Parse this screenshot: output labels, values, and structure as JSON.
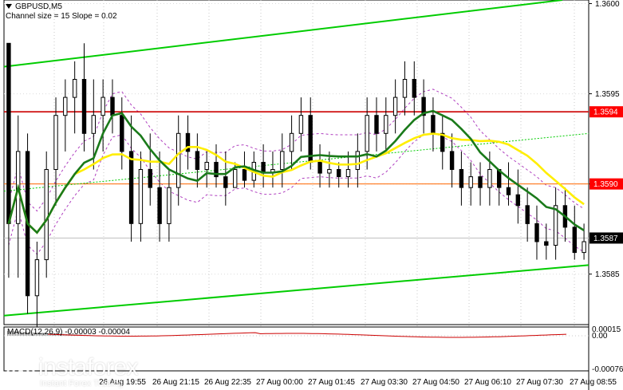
{
  "header": {
    "symbol": "GBPUSD,M5",
    "channel_text": "Channel size = 15 Slope = 0.02"
  },
  "macd": {
    "label": "MACD(12,26,9) -0.00003 -0.00004",
    "axis_top": "0.00015",
    "axis_zero": "0.00",
    "axis_bottom": "-0.00076"
  },
  "logo": {
    "name": "instaforex",
    "tagline": "Instant Forex Trading",
    "brand_color": "#ffffff"
  },
  "chart_data": {
    "type": "candlestick",
    "ylim": [
      1.35822,
      1.36002
    ],
    "y_ticks": [
      1.36,
      1.3595,
      1.359,
      1.3585
    ],
    "y_tick_labels": [
      "1.3600",
      "1.3595",
      "1.3590",
      "1.3585"
    ],
    "price_labels": [
      {
        "value": 1.3594,
        "label": "1.3594",
        "color": "#ff0000"
      },
      {
        "value": 1.359,
        "label": "1.3590",
        "color": "#ff0000"
      },
      {
        "value": 1.3587,
        "label": "1.3587",
        "color": "#000000"
      }
    ],
    "x_labels": [
      "26 Aug 19:55",
      "26 Aug 21:15",
      "26 Aug 22:35",
      "27 Aug 00:00",
      "27 Aug 01:45",
      "27 Aug 03:30",
      "27 Aug 04:50",
      "27 Aug 06:10",
      "27 Aug 07:30",
      "27 Aug 08:55"
    ],
    "horizontal_lines": [
      {
        "value": 1.3594,
        "color": "#cc0000"
      },
      {
        "value": 1.359,
        "color": "#ff6600"
      }
    ],
    "ma_colors": {
      "fast": "#1a7a1a",
      "slow": "#ffee00",
      "channel": "#00cc00",
      "envelope": "#b040c0"
    },
    "candles": [
      [
        1.35978,
        1.35978,
        1.35848,
        1.35878
      ],
      [
        1.35878,
        1.35938,
        1.35848,
        1.35918
      ],
      [
        1.35918,
        1.35928,
        1.35828,
        1.35838
      ],
      [
        1.35838,
        1.35868,
        1.35818,
        1.35858
      ],
      [
        1.35858,
        1.35918,
        1.35848,
        1.35908
      ],
      [
        1.35908,
        1.35948,
        1.35888,
        1.35938
      ],
      [
        1.35938,
        1.35958,
        1.35918,
        1.35948
      ],
      [
        1.35948,
        1.35968,
        1.35928,
        1.35958
      ],
      [
        1.35958,
        1.35978,
        1.35918,
        1.35928
      ],
      [
        1.35928,
        1.35958,
        1.35908,
        1.35938
      ],
      [
        1.35938,
        1.35958,
        1.35918,
        1.35948
      ],
      [
        1.35948,
        1.35958,
        1.35928,
        1.35938
      ],
      [
        1.35938,
        1.35948,
        1.35908,
        1.35918
      ],
      [
        1.35918,
        1.35938,
        1.35868,
        1.35878
      ],
      [
        1.35878,
        1.35918,
        1.35868,
        1.35908
      ],
      [
        1.35908,
        1.35928,
        1.35888,
        1.35898
      ],
      [
        1.35898,
        1.35918,
        1.35868,
        1.35878
      ],
      [
        1.35878,
        1.35908,
        1.35868,
        1.35898
      ],
      [
        1.35898,
        1.35938,
        1.35888,
        1.35928
      ],
      [
        1.35928,
        1.35938,
        1.35908,
        1.35918
      ],
      [
        1.35918,
        1.35928,
        1.35898,
        1.35908
      ],
      [
        1.35908,
        1.35918,
        1.35898,
        1.35912
      ],
      [
        1.35912,
        1.35922,
        1.35898,
        1.35904
      ],
      [
        1.35904,
        1.35918,
        1.35888,
        1.35898
      ],
      [
        1.35898,
        1.35912,
        1.35898,
        1.35908
      ],
      [
        1.35908,
        1.35918,
        1.35898,
        1.35902
      ],
      [
        1.35902,
        1.35918,
        1.35898,
        1.35912
      ],
      [
        1.35912,
        1.35922,
        1.35898,
        1.35906
      ],
      [
        1.35906,
        1.35918,
        1.35898,
        1.35908
      ],
      [
        1.35908,
        1.35928,
        1.35898,
        1.35918
      ],
      [
        1.35918,
        1.35938,
        1.35908,
        1.35928
      ],
      [
        1.35928,
        1.35948,
        1.35918,
        1.35938
      ],
      [
        1.35938,
        1.35948,
        1.35908,
        1.35912
      ],
      [
        1.35912,
        1.35922,
        1.35898,
        1.35906
      ],
      [
        1.35906,
        1.35918,
        1.35898,
        1.35908
      ],
      [
        1.35908,
        1.35912,
        1.35898,
        1.35904
      ],
      [
        1.35904,
        1.35918,
        1.35898,
        1.35908
      ],
      [
        1.35908,
        1.35928,
        1.35898,
        1.35918
      ],
      [
        1.35918,
        1.35948,
        1.35908,
        1.35938
      ],
      [
        1.35938,
        1.35948,
        1.35918,
        1.35928
      ],
      [
        1.35928,
        1.35948,
        1.35918,
        1.35938
      ],
      [
        1.35938,
        1.35958,
        1.35928,
        1.35948
      ],
      [
        1.35948,
        1.35968,
        1.35938,
        1.35958
      ],
      [
        1.35958,
        1.35968,
        1.35938,
        1.35948
      ],
      [
        1.35948,
        1.35958,
        1.35928,
        1.35938
      ],
      [
        1.35938,
        1.35948,
        1.35918,
        1.35928
      ],
      [
        1.35928,
        1.35938,
        1.35908,
        1.35918
      ],
      [
        1.35918,
        1.35928,
        1.35898,
        1.35908
      ],
      [
        1.35908,
        1.35918,
        1.35888,
        1.35898
      ],
      [
        1.35898,
        1.35912,
        1.35888,
        1.35904
      ],
      [
        1.35904,
        1.35912,
        1.35888,
        1.35898
      ],
      [
        1.35898,
        1.35918,
        1.35888,
        1.35908
      ],
      [
        1.35908,
        1.35908,
        1.35888,
        1.35898
      ],
      [
        1.35898,
        1.35912,
        1.35888,
        1.35894
      ],
      [
        1.35894,
        1.35908,
        1.35878,
        1.35888
      ],
      [
        1.35888,
        1.35898,
        1.35868,
        1.35878
      ],
      [
        1.35878,
        1.35888,
        1.35858,
        1.35868
      ],
      [
        1.35868,
        1.35878,
        1.35858,
        1.35866
      ],
      [
        1.35866,
        1.35898,
        1.35858,
        1.35888
      ],
      [
        1.35888,
        1.35898,
        1.35868,
        1.35876
      ],
      [
        1.35876,
        1.35888,
        1.35858,
        1.35862
      ],
      [
        1.35862,
        1.35878,
        1.35858,
        1.35868
      ]
    ]
  }
}
